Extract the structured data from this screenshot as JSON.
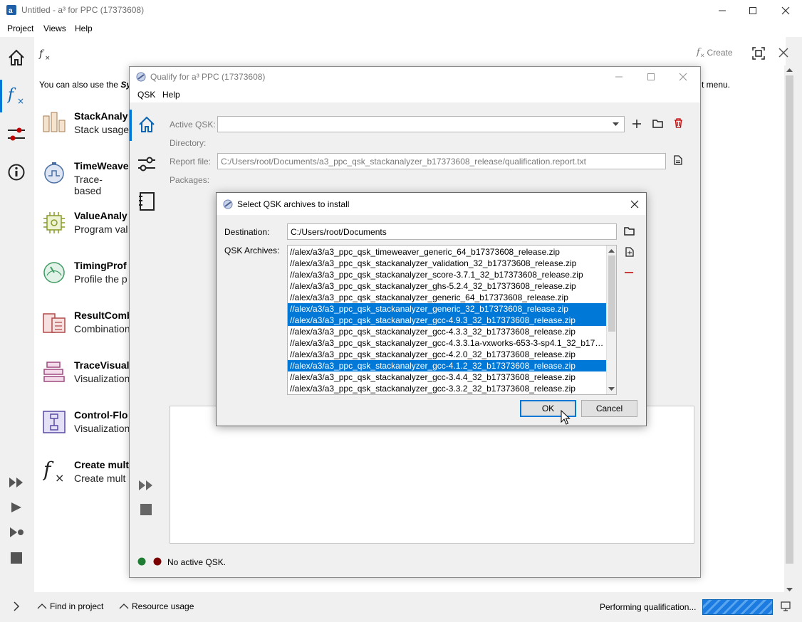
{
  "window": {
    "title": "Untitled - a³ for PPC (17373608)"
  },
  "menubar": {
    "items": [
      "Project",
      "Views",
      "Help"
    ]
  },
  "content_header": {
    "create_label": "Create",
    "fx_glyph": "f×"
  },
  "hint": {
    "prefix": "You can also use the",
    "bold_fragment": "Sy",
    "suffix": "t menu."
  },
  "tools": [
    {
      "name": "StackAnaly",
      "desc": "Stack usage",
      "icon": "bar-chart-icon"
    },
    {
      "name": "TimeWeave",
      "desc": "Trace-based",
      "icon": "timeweaver-icon"
    },
    {
      "name": "ValueAnaly",
      "desc": "Program val",
      "icon": "chip-icon"
    },
    {
      "name": "TimingProf",
      "desc": "Profile the p",
      "icon": "gauge-icon"
    },
    {
      "name": "ResultComb",
      "desc": "Combination",
      "icon": "result-combine-icon"
    },
    {
      "name": "TraceVisual",
      "desc": "Visualization",
      "icon": "trace-visual-icon"
    },
    {
      "name": "Control-Flo",
      "desc": "Visualization",
      "icon": "control-flow-icon"
    },
    {
      "name": "Create mult",
      "desc": "Create mult",
      "icon": "fx-icon"
    }
  ],
  "statusbar": {
    "find": "Find in project",
    "resource": "Resource usage",
    "status": "Performing qualification..."
  },
  "qualify": {
    "title": "Qualify for a³ PPC (17373608)",
    "menu": [
      "QSK",
      "Help"
    ],
    "active_qsk_label": "Active QSK:",
    "active_qsk_value": "",
    "directory_label": "Directory:",
    "report_label": "Report file:",
    "report_value": "C:/Users/root/Documents/a3_ppc_qsk_stackanalyzer_b17373608_release/qualification.report.txt",
    "packages_label": "Packages:",
    "status_text": "No active QSK.",
    "status_colors": [
      "#1e7d32",
      "#7a0000"
    ]
  },
  "dialog": {
    "title": "Select QSK archives to install",
    "destination_label": "Destination:",
    "destination_value": "C:/Users/root/Documents",
    "archives_label": "QSK Archives:",
    "archives": [
      {
        "path": "//alex/a3/a3_ppc_qsk_timeweaver_generic_64_b17373608_release.zip",
        "selected": false
      },
      {
        "path": "//alex/a3/a3_ppc_qsk_stackanalyzer_validation_32_b17373608_release.zip",
        "selected": false
      },
      {
        "path": "//alex/a3/a3_ppc_qsk_stackanalyzer_score-3.7.1_32_b17373608_release.zip",
        "selected": false
      },
      {
        "path": "//alex/a3/a3_ppc_qsk_stackanalyzer_ghs-5.2.4_32_b17373608_release.zip",
        "selected": false
      },
      {
        "path": "//alex/a3/a3_ppc_qsk_stackanalyzer_generic_64_b17373608_release.zip",
        "selected": false
      },
      {
        "path": "//alex/a3/a3_ppc_qsk_stackanalyzer_generic_32_b17373608_release.zip",
        "selected": true
      },
      {
        "path": "//alex/a3/a3_ppc_qsk_stackanalyzer_gcc-4.9.3_32_b17373608_release.zip",
        "selected": true
      },
      {
        "path": "//alex/a3/a3_ppc_qsk_stackanalyzer_gcc-4.3.3_32_b17373608_release.zip",
        "selected": false
      },
      {
        "path": "//alex/a3/a3_ppc_qsk_stackanalyzer_gcc-4.3.3.1a-vxworks-653-3-sp4.1_32_b1737...",
        "selected": false
      },
      {
        "path": "//alex/a3/a3_ppc_qsk_stackanalyzer_gcc-4.2.0_32_b17373608_release.zip",
        "selected": false
      },
      {
        "path": "//alex/a3/a3_ppc_qsk_stackanalyzer_gcc-4.1.2_32_b17373608_release.zip",
        "selected": true
      },
      {
        "path": "//alex/a3/a3_ppc_qsk_stackanalyzer_gcc-3.4.4_32_b17373608_release.zip",
        "selected": false
      },
      {
        "path": "//alex/a3/a3_ppc_qsk_stackanalyzer_gcc-3.3.2_32_b17373608_release.zip",
        "selected": false
      }
    ],
    "ok_label": "OK",
    "cancel_label": "Cancel",
    "accent": "#0078d7"
  }
}
